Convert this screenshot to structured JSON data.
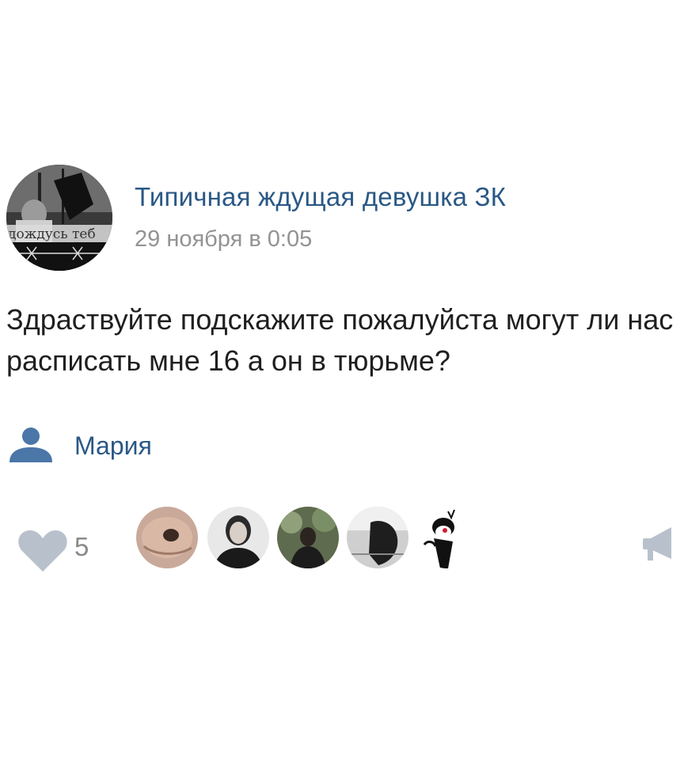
{
  "post": {
    "author_name": "Типичная ждущая девушка ЗК",
    "avatar_caption": "дождусь теб",
    "date": "29 ноября в 0:05",
    "text": "Здраствуйте подскажите пожалуйста могут ли нас расписать мне 16 а он в тюрьме?",
    "signer": {
      "name": "Мария",
      "icon": "person-icon"
    },
    "likes": {
      "count": "5",
      "icon": "heart-icon",
      "likers": [
        "liker-1",
        "liker-2",
        "liker-3",
        "liker-4",
        "liker-5"
      ]
    },
    "share_icon": "megaphone-icon"
  },
  "colors": {
    "link": "#2a5885",
    "date": "#939393",
    "text": "#1f1f1f",
    "icon_gray": "#b8c1cb",
    "person_icon": "#4a76a8"
  }
}
